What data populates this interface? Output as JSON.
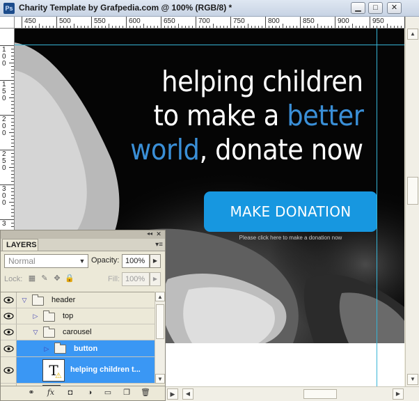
{
  "window": {
    "app_icon": "Ps",
    "title": "Charity Template by Grafpedia.com @ 100% (RGB/8) *",
    "minimize_label": "▁",
    "maximize_label": "□",
    "close_label": "✕"
  },
  "ruler": {
    "top_ticks": [
      "450",
      "500",
      "550",
      "600",
      "650",
      "700",
      "750",
      "800",
      "850",
      "900",
      "950"
    ],
    "left_ticks": [
      "100",
      "150",
      "200",
      "250",
      "300",
      "3"
    ]
  },
  "canvas": {
    "headline_line1": "helping children",
    "headline_line2_prefix": "to make a ",
    "headline_line2_accent": "better",
    "headline_line3_accent": "world",
    "headline_line3_suffix": ", donate now",
    "button_label": "MAKE DONATION",
    "button_subtext": "Please click here to make a donation now",
    "accent_color": "#3a8fd7",
    "button_color": "#1797e0"
  },
  "layers_panel": {
    "tab_label": "LAYERS",
    "menu_icon": "panel-menu-icon",
    "collapse_icon": "◂◂",
    "close_label": "✕",
    "blend_mode": "Normal",
    "opacity_label": "Opacity:",
    "opacity_value": "100%",
    "lock_label": "Lock:",
    "fill_label": "Fill:",
    "fill_value": "100%",
    "layers": [
      {
        "name": "header",
        "type": "group",
        "expanded": true,
        "selected": false
      },
      {
        "name": "top",
        "type": "group",
        "expanded": false,
        "selected": false
      },
      {
        "name": "carousel",
        "type": "group",
        "expanded": true,
        "selected": false
      },
      {
        "name": "button",
        "type": "group",
        "expanded": false,
        "selected": true
      },
      {
        "name": "helping children t...",
        "type": "text",
        "selected": true
      }
    ],
    "footer_icons": [
      "link-icon",
      "fx-icon",
      "mask-icon",
      "adjustment-icon",
      "folder-icon",
      "new-layer-icon",
      "trash-icon"
    ]
  }
}
